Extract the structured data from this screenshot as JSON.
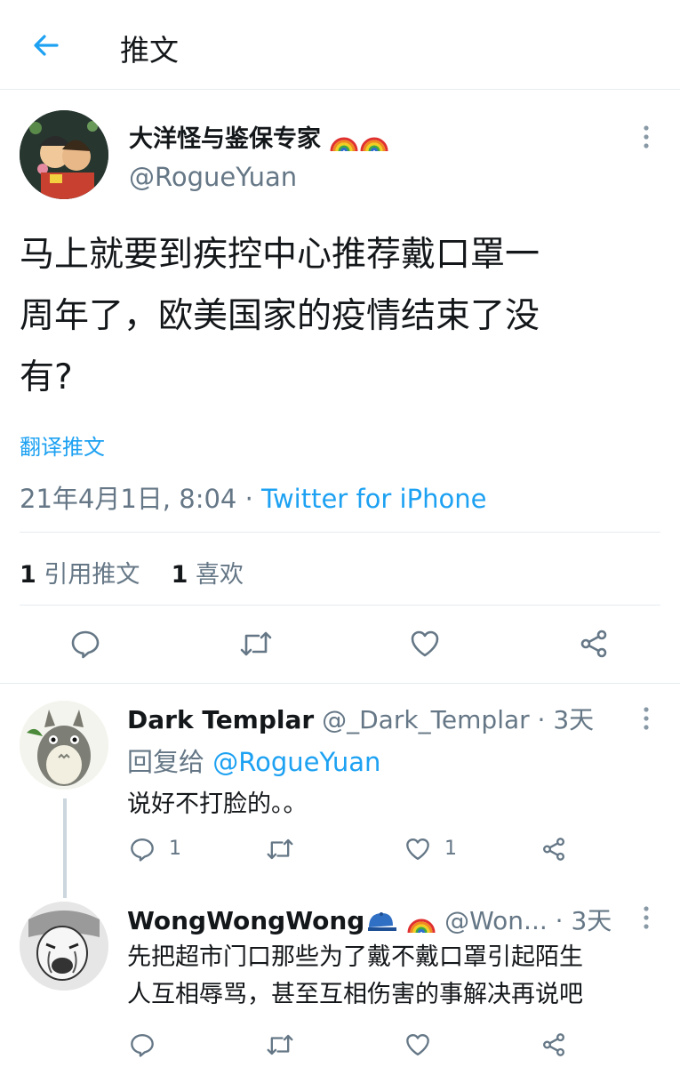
{
  "header": {
    "title": "推文"
  },
  "main_tweet": {
    "display_name": "大洋怪与鉴保专家",
    "handle": "@RogueYuan",
    "text_lines": [
      "马上就要到疾控中心推荐戴口罩一",
      "周年了，欧美国家的疫情结束了没",
      "有?"
    ],
    "translate_label": "翻译推文",
    "date": "21年4月1日, 8:04 ·",
    "source": "Twitter for iPhone",
    "stats": {
      "quote_count": "1",
      "quote_label": "引用推文",
      "like_count": "1",
      "like_label": "喜欢"
    }
  },
  "replies": [
    {
      "display_name": "Dark Templar",
      "handle": "@_Dark_Templar",
      "time": "· 3天",
      "reply_to_label": "回复给",
      "reply_to_handle": "@RogueYuan",
      "text_lines": [
        "说好不打脸的。。"
      ],
      "reply_count": "1",
      "like_count": "1"
    },
    {
      "display_name": "WongWongWong",
      "handle": "@Won...",
      "time": "· 3天",
      "text_lines": [
        "先把超市门口那些为了戴不戴口罩引起陌生",
        "人互相辱骂，甚至互相伤害的事解决再说吧"
      ]
    }
  ],
  "colors": {
    "accent": "#1da1f2",
    "muted": "#657786",
    "divider": "#e6ecf0"
  }
}
